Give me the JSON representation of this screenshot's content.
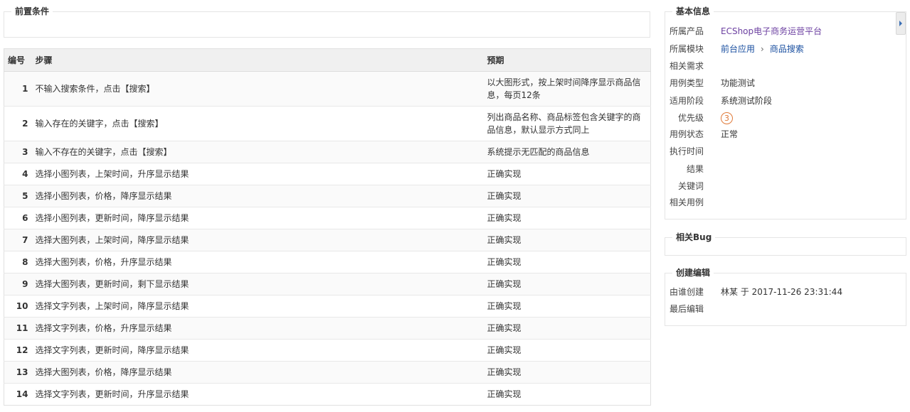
{
  "precondition": {
    "legend": "前置条件"
  },
  "steps": {
    "headers": {
      "no": "编号",
      "step": "步骤",
      "expect": "预期"
    },
    "rows": [
      {
        "no": "1",
        "step": "不输入搜索条件，点击【搜索】",
        "expect": "以大图形式，按上架时间降序显示商品信息，每页12条"
      },
      {
        "no": "2",
        "step": "输入存在的关键字，点击【搜索】",
        "expect": "列出商品名称、商品标签包含关键字的商品信息，默认显示方式同上"
      },
      {
        "no": "3",
        "step": "输入不存在的关键字，点击【搜索】",
        "expect": "系统提示无匹配的商品信息"
      },
      {
        "no": "4",
        "step": "选择小图列表，上架时间，升序显示结果",
        "expect": "正确实现"
      },
      {
        "no": "5",
        "step": "选择小图列表，价格，降序显示结果",
        "expect": "正确实现"
      },
      {
        "no": "6",
        "step": "选择小图列表，更新时间，降序显示结果",
        "expect": "正确实现"
      },
      {
        "no": "7",
        "step": "选择大图列表，上架时间，降序显示结果",
        "expect": "正确实现"
      },
      {
        "no": "8",
        "step": "选择大图列表，价格，升序显示结果",
        "expect": "正确实现"
      },
      {
        "no": "9",
        "step": "选择大图列表，更新时间，剩下显示结果",
        "expect": "正确实现"
      },
      {
        "no": "10",
        "step": "选择文字列表，上架时间，降序显示结果",
        "expect": "正确实现"
      },
      {
        "no": "11",
        "step": "选择文字列表，价格，升序显示结果",
        "expect": "正确实现"
      },
      {
        "no": "12",
        "step": "选择文字列表，更新时间，降序显示结果",
        "expect": "正确实现"
      },
      {
        "no": "13",
        "step": "选择大图列表，价格，降序显示结果",
        "expect": "正确实现"
      },
      {
        "no": "14",
        "step": "选择文字列表，更新时间，升序显示结果",
        "expect": "正确实现"
      }
    ]
  },
  "basic_info": {
    "legend": "基本信息",
    "product_label": "所属产品",
    "product_value": "ECShop电子商务运营平台",
    "module_label": "所属模块",
    "module_parent": "前台应用",
    "module_sep": "›",
    "module_child": "商品搜索",
    "story_label": "相关需求",
    "type_label": "用例类型",
    "type_value": "功能测试",
    "stage_label": "适用阶段",
    "stage_value": "系统测试阶段",
    "priority_label": "优先级",
    "priority_value": "3",
    "status_label": "用例状态",
    "status_value": "正常",
    "exec_time_label": "执行时间",
    "result_label": "结果",
    "keywords_label": "关键词",
    "linked_label": "相关用例"
  },
  "related_bug": {
    "legend": "相关Bug"
  },
  "edit_info": {
    "legend": "创建编辑",
    "created_label": "由谁创建",
    "created_value": "林某 于 2017-11-26 23:31:44",
    "edited_label": "最后编辑"
  },
  "colors": {
    "link": "#1a4fa0",
    "priority": "#e07a3a",
    "header_bg": "#f0f0f0"
  }
}
